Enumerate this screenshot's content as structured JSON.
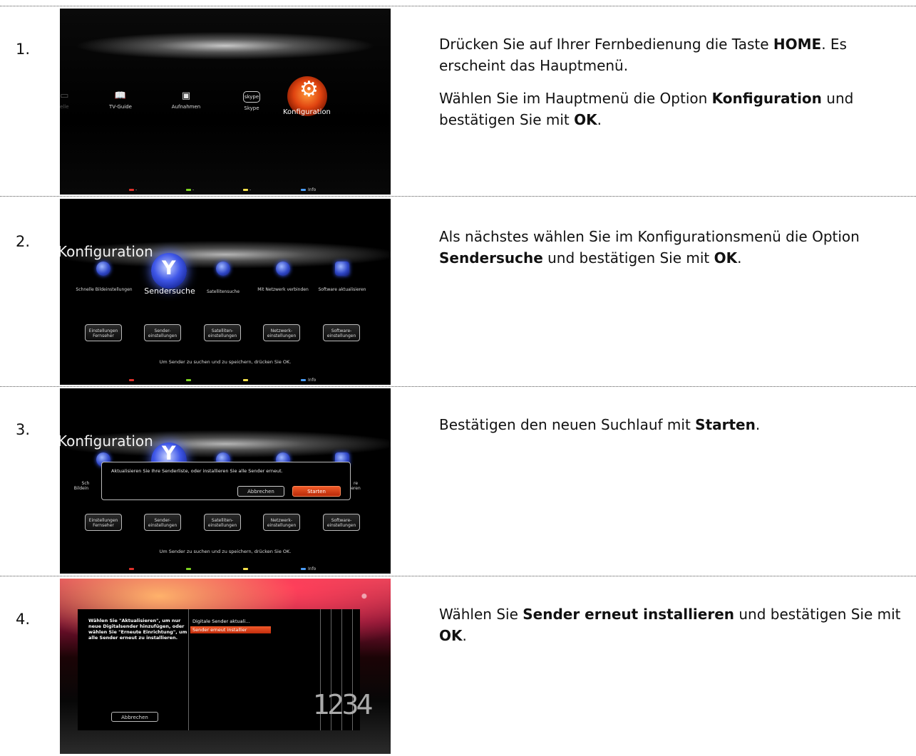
{
  "steps": [
    {
      "number": "1.",
      "paragraphs": [
        [
          "Drücken Sie auf Ihrer Fernbedienung die Taste ",
          "HOME",
          ". Es erscheint das Hauptmenü."
        ],
        [
          "Wählen Sie im Hauptmenü die Option ",
          "Konfiguration",
          " und bestätigen Sie mit ",
          "OK",
          "."
        ]
      ]
    },
    {
      "number": "2.",
      "paragraphs": [
        [
          "Als nächstes wählen Sie im Konfigurationsmenü die Option ",
          "Sendersuche",
          " und bestätigen Sie mit ",
          "OK",
          "."
        ]
      ]
    },
    {
      "number": "3.",
      "paragraphs": [
        [
          "Bestätigen den neuen Suchlauf mit ",
          "Starten",
          "."
        ]
      ]
    },
    {
      "number": "4.",
      "paragraphs": [
        [
          "Wählen Sie ",
          "Sender erneut installieren",
          " und bestätigen Sie mit ",
          "OK",
          "."
        ]
      ]
    }
  ],
  "screen1": {
    "items": [
      "TV-Guide",
      "Aufnahmen",
      "Skype",
      "Konfiguration"
    ],
    "partial_item": "elle",
    "skype_logo": "skype",
    "info_label": "Info",
    "dot_labels": [
      "-",
      "-",
      "-"
    ]
  },
  "screen2": {
    "title": "Konfiguration",
    "items": [
      "Schnelle Bildeinstellungen",
      "Sendersuche",
      "Satellitensuche",
      "Mit Netzwerk verbinden",
      "Software aktualisieren"
    ],
    "buttons": [
      "Einstellungen Fernseher",
      "Sender-einstellungen",
      "Satelliten-einstellungen",
      "Netzwerk-einstellungen",
      "Software-einstellungen"
    ],
    "hint": "Um Sender zu suchen und zu speichern, drücken Sie OK.",
    "info_label": "Info"
  },
  "screen3": {
    "title": "Konfiguration",
    "dialog_message": "Aktualisieren Sie Ihre Senderliste, oder installieren Sie alle Sender erneut.",
    "cancel": "Abbrechen",
    "start": "Starten",
    "partial_left": [
      "Sch",
      "Bildein"
    ],
    "partial_right": [
      "re",
      "eren"
    ],
    "buttons": [
      "Einstellungen Fernseher",
      "Sender-einstellungen",
      "Satelliten-einstellungen",
      "Netzwerk-einstellungen",
      "Software-einstellungen"
    ],
    "hint": "Um Sender zu suchen und zu speichern, drücken Sie OK.",
    "info_label": "Info"
  },
  "screen4": {
    "message": "Wählen Sie \"Aktualisieren\", um nur neue Digitalsender hinzufügen, oder wählen Sie \"Erneute Einrichtung\", um alle Sender erneut zu installieren.",
    "options": [
      "Digitale Sender aktuali...",
      "Sender erneut installier"
    ],
    "cancel": "Abbrechen",
    "steps_graphic": "1234"
  },
  "colors": {
    "accent_orange": "#e8501e",
    "selection_blue": "#3f57e8",
    "dot_red": "#e0302a",
    "dot_green": "#7ed321",
    "dot_yellow": "#f5e04a",
    "dot_blue": "#4a9cf5"
  }
}
